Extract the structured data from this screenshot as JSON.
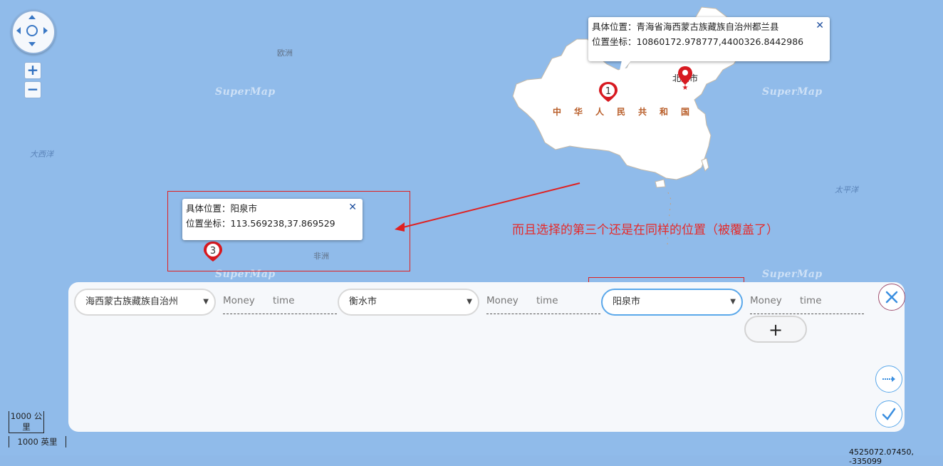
{
  "map": {
    "labels": {
      "europe": "欧洲",
      "atlantic": "大西洋",
      "pacific": "太平洋",
      "africa": "非洲",
      "china": "中华人民共和国",
      "beijing": "北京市"
    },
    "watermark": "SuperMap",
    "controls": {
      "zoom_in": "+",
      "zoom_out": "−"
    },
    "scale": {
      "km": "1000 公里",
      "mi": "1000 英里"
    },
    "coordinates": "4525072.07450, -335099"
  },
  "popups": {
    "top": {
      "location_label": "具体位置：",
      "location_value": "青海省海西蒙古族藏族自治州都兰县",
      "coord_label": "位置坐标：",
      "coord_value": "10860172.978777,4400326.8442986",
      "close": "✕"
    },
    "bottom": {
      "location_label": "具体位置：",
      "location_value": "阳泉市",
      "coord_label": "位置坐标：",
      "coord_value": "113.569238,37.869529",
      "close": "✕"
    }
  },
  "markers": [
    "1",
    "3"
  ],
  "annotation": {
    "text": "而且选择的第三个还是在同样的位置（被覆盖了）",
    "color": "#e52b2b"
  },
  "panel": {
    "selects": [
      {
        "value": "海西蒙古族藏族自治州"
      },
      {
        "value": "衡水市"
      },
      {
        "value": "阳泉市"
      }
    ],
    "fields": {
      "money": "Money",
      "time": "time"
    },
    "add_label": "+",
    "close_icon": "close-icon",
    "next_icon": "arrow-right-icon",
    "confirm_icon": "check-icon",
    "accent_color": "#5ba8ea"
  }
}
